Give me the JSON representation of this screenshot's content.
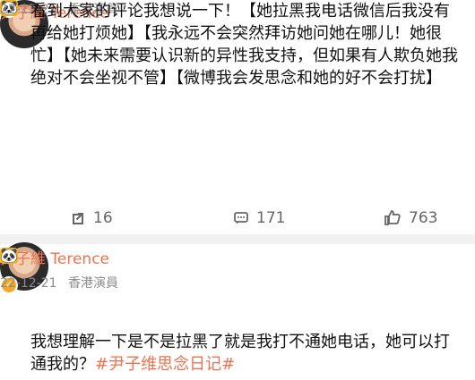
{
  "posts": [
    {
      "author": "尹子維 Terence",
      "date": "22-12-21",
      "source": "香港演員",
      "text": "看到大家的评论我想说一下！【她拉黑我电话微信后我没有再给她打烦她】【我永远不会突然拜访她问她在哪儿！她很忙】【她未来需要认识新的异性我支持，但如果有人欺负她我绝对不会坐视不管】【微博我会发思念和她的好不会打扰】",
      "stats": {
        "reposts": "16",
        "comments": "171",
        "likes": "763"
      }
    },
    {
      "author": "尹子維 Terence",
      "date": "22-12-21",
      "source": "香港演員",
      "text_prefix": "我想理解一下是不是拉黑了就是我打不通她电话，她可以打通我的？",
      "hashtag": "#尹子维思念日记#"
    }
  ],
  "icons": [
    "repost-icon",
    "comment-icon",
    "like-icon",
    "crown-badge-icon",
    "panda-icon",
    "verified-icon"
  ],
  "colors": {
    "accent": "#eb7350",
    "muted": "#8c8c8c",
    "divider": "#f1f1f1"
  }
}
